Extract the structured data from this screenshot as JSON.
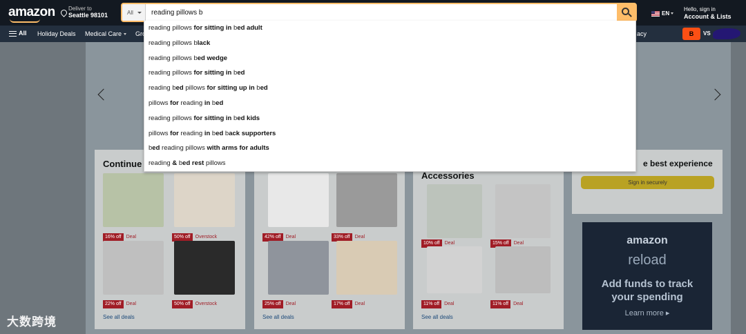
{
  "header": {
    "logo": "amazon",
    "deliver_line1": "Deliver to",
    "deliver_line2": "Seattle 98101",
    "search_category": "All",
    "search_value": "reading pillows b",
    "language": "EN",
    "account_line1": "Hello, sign in",
    "account_line2": "Account & Lists"
  },
  "subnav": {
    "all_label": "All",
    "links": [
      "Holiday Deals",
      "Medical Care",
      "Gro",
      "acy"
    ],
    "promo_vs": "VS"
  },
  "suggestions": [
    [
      {
        "t": "reading pillows ",
        "b": false
      },
      {
        "t": "for sitting in",
        "b": true
      },
      {
        "t": " b",
        "b": false
      },
      {
        "t": "ed adult",
        "b": true
      }
    ],
    [
      {
        "t": "reading pillows b",
        "b": false
      },
      {
        "t": "lack",
        "b": true
      }
    ],
    [
      {
        "t": "reading pillows b",
        "b": false
      },
      {
        "t": "ed wedge",
        "b": true
      }
    ],
    [
      {
        "t": "reading pillows ",
        "b": false
      },
      {
        "t": "for sitting in",
        "b": true
      },
      {
        "t": " b",
        "b": false
      },
      {
        "t": "ed",
        "b": true
      }
    ],
    [
      {
        "t": "reading b",
        "b": false
      },
      {
        "t": "ed",
        "b": true
      },
      {
        "t": " pillows ",
        "b": false
      },
      {
        "t": "for sitting up in",
        "b": true
      },
      {
        "t": " b",
        "b": false
      },
      {
        "t": "ed",
        "b": true
      }
    ],
    [
      {
        "t": "pillows ",
        "b": false
      },
      {
        "t": "for",
        "b": true
      },
      {
        "t": " reading ",
        "b": false
      },
      {
        "t": "in",
        "b": true
      },
      {
        "t": " b",
        "b": false
      },
      {
        "t": "ed",
        "b": true
      }
    ],
    [
      {
        "t": "reading pillows ",
        "b": false
      },
      {
        "t": "for sitting in",
        "b": true
      },
      {
        "t": " b",
        "b": false
      },
      {
        "t": "ed kids",
        "b": true
      }
    ],
    [
      {
        "t": "pillows ",
        "b": false
      },
      {
        "t": "for",
        "b": true
      },
      {
        "t": " reading ",
        "b": false
      },
      {
        "t": "in",
        "b": true
      },
      {
        "t": " b",
        "b": false
      },
      {
        "t": "ed",
        "b": true
      },
      {
        "t": " b",
        "b": false
      },
      {
        "t": "ack supporters",
        "b": true
      }
    ],
    [
      {
        "t": "b",
        "b": false
      },
      {
        "t": "ed",
        "b": true
      },
      {
        "t": " reading pillows ",
        "b": false
      },
      {
        "t": "with arms for adults",
        "b": true
      }
    ],
    [
      {
        "t": "reading ",
        "b": false
      },
      {
        "t": "&",
        "b": true
      },
      {
        "t": " b",
        "b": false
      },
      {
        "t": "ed rest",
        "b": true
      },
      {
        "t": " pillows",
        "b": false
      }
    ]
  ],
  "cards": {
    "continue": {
      "title": "Continue",
      "see_all": "See all deals",
      "items": [
        {
          "badge": "16% off",
          "label": "Deal"
        },
        {
          "badge": "50% off",
          "label": "Overstock"
        },
        {
          "badge": "22% off",
          "label": "Deal"
        },
        {
          "badge": "50% off",
          "label": "Overstock"
        }
      ]
    },
    "bedding": {
      "see_all": "See all deals",
      "items": [
        {
          "badge": "42% off",
          "label": "Deal"
        },
        {
          "badge": "33% off",
          "label": "Deal"
        },
        {
          "badge": "25% off",
          "label": "Deal"
        },
        {
          "badge": "17% off",
          "label": "Deal"
        }
      ]
    },
    "accessories": {
      "title": "Accessories",
      "see_all": "See all deals",
      "items": [
        {
          "badge": "10% off",
          "label": "Deal"
        },
        {
          "badge": "15% off",
          "label": "Deal"
        },
        {
          "badge": "11% off",
          "label": "Deal"
        },
        {
          "badge": "11% off",
          "label": "Deal"
        }
      ]
    },
    "signin": {
      "title": "e best experience",
      "button": "Sign in securely"
    },
    "reload": {
      "brand": "amazon",
      "name": "reload",
      "headline": "Add funds to track your spending",
      "cta": "Learn more ▸"
    }
  },
  "watermark": "大数跨境",
  "colors": {
    "nav": "#131921",
    "subnav": "#232f3e",
    "search_button": "#febd69",
    "deal_badge": "#a01d26"
  }
}
